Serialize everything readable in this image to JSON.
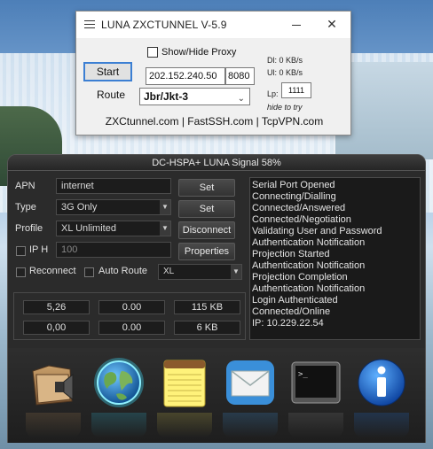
{
  "window": {
    "title": "LUNA ZXCTUNNEL V-5.9",
    "close_glyph": "✕",
    "show_hide_proxy": "Show/Hide Proxy",
    "start_label": "Start",
    "proxy_ip": "202.152.240.50",
    "proxy_port": "8080",
    "route_label": "Route",
    "route_value": "Jbr/Jkt-3",
    "dl": "Dl: 0 KB/s",
    "ul": "Ul: 0 KB/s",
    "lp_label": "Lp:",
    "lp_value": "1111",
    "hide_to_try": "hide to try",
    "links": "ZXCtunnel.com | FastSSH.com | TcpVPN.com"
  },
  "panel": {
    "header": "DC-HSPA+ LUNA Signal 58%",
    "apn_label": "APN",
    "apn_value": "internet",
    "type_label": "Type",
    "type_value": "3G Only",
    "profile_label": "Profile",
    "profile_value": "XL Unlimited",
    "iph_label": "IP H",
    "iph_value": "100",
    "reconnect_label": "Reconnect",
    "auto_route_label": "Auto Route",
    "auto_route_value": "XL",
    "set1": "Set",
    "set2": "Set",
    "disconnect": "Disconnect",
    "properties": "Properties",
    "stats": {
      "r1c1": "5,26",
      "r1c2": "0.00",
      "r1c3": "115 KB",
      "r2c1": "0,00",
      "r2c2": "0.00",
      "r2c3": "6 KB"
    },
    "log": [
      "Serial Port Opened",
      "Connecting/Dialling",
      "Connected/Answered",
      "Connected/Negotiation",
      "Validating User and Password",
      "Authentication Notification",
      "Projection Started",
      "Authentication Notification",
      "Projection Completion",
      "Authentication Notification",
      "Login Authenticated",
      "Connected/Online",
      "IP: 10.229.22.54"
    ]
  },
  "dock": {
    "icons": [
      "speaker-folder-icon",
      "globe-icon",
      "notepad-icon",
      "mail-icon",
      "terminal-icon",
      "info-icon"
    ]
  }
}
